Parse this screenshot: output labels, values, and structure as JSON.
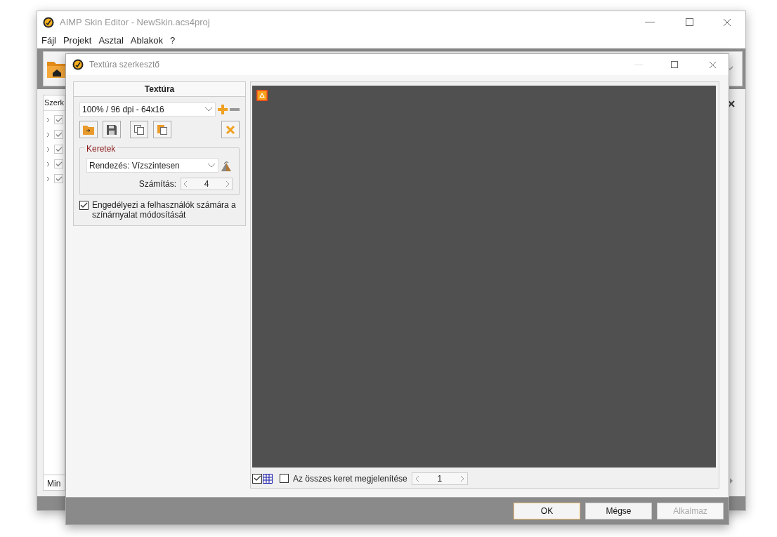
{
  "main_window": {
    "title": "AIMP Skin Editor - NewSkin.acs4proj",
    "menu": [
      "Fájl",
      "Projekt",
      "Asztal",
      "Ablakok",
      "?"
    ],
    "panel": {
      "header": "Szerk",
      "tree_rows": [
        {
          "checked": true
        },
        {
          "checked": true
        },
        {
          "checked": true
        },
        {
          "checked": true
        },
        {
          "checked": true
        }
      ],
      "tab": "Min"
    }
  },
  "dialog": {
    "title": "Textúra szerkesztő",
    "texture_panel": {
      "header": "Textúra",
      "size_select": "100% / 96 dpi - 64x16",
      "frames": {
        "legend": "Keretek",
        "arrangement": "Rendezés: Vízszintesen",
        "count_label": "Számítás:",
        "count": "4"
      },
      "allow_hue": {
        "label": "Engedélyezi a felhasználók számára a színárnyalat módosítását",
        "checked": true
      }
    },
    "preview": {
      "grid_checked": true,
      "show_all_frames": {
        "label": "Az összes keret megjelenítése",
        "checked": false
      },
      "frame": "1"
    },
    "buttons": [
      {
        "label": "OK",
        "default": true,
        "disabled": false
      },
      {
        "label": "Mégse",
        "default": false,
        "disabled": false
      },
      {
        "label": "Alkalmaz",
        "default": false,
        "disabled": true
      }
    ]
  }
}
